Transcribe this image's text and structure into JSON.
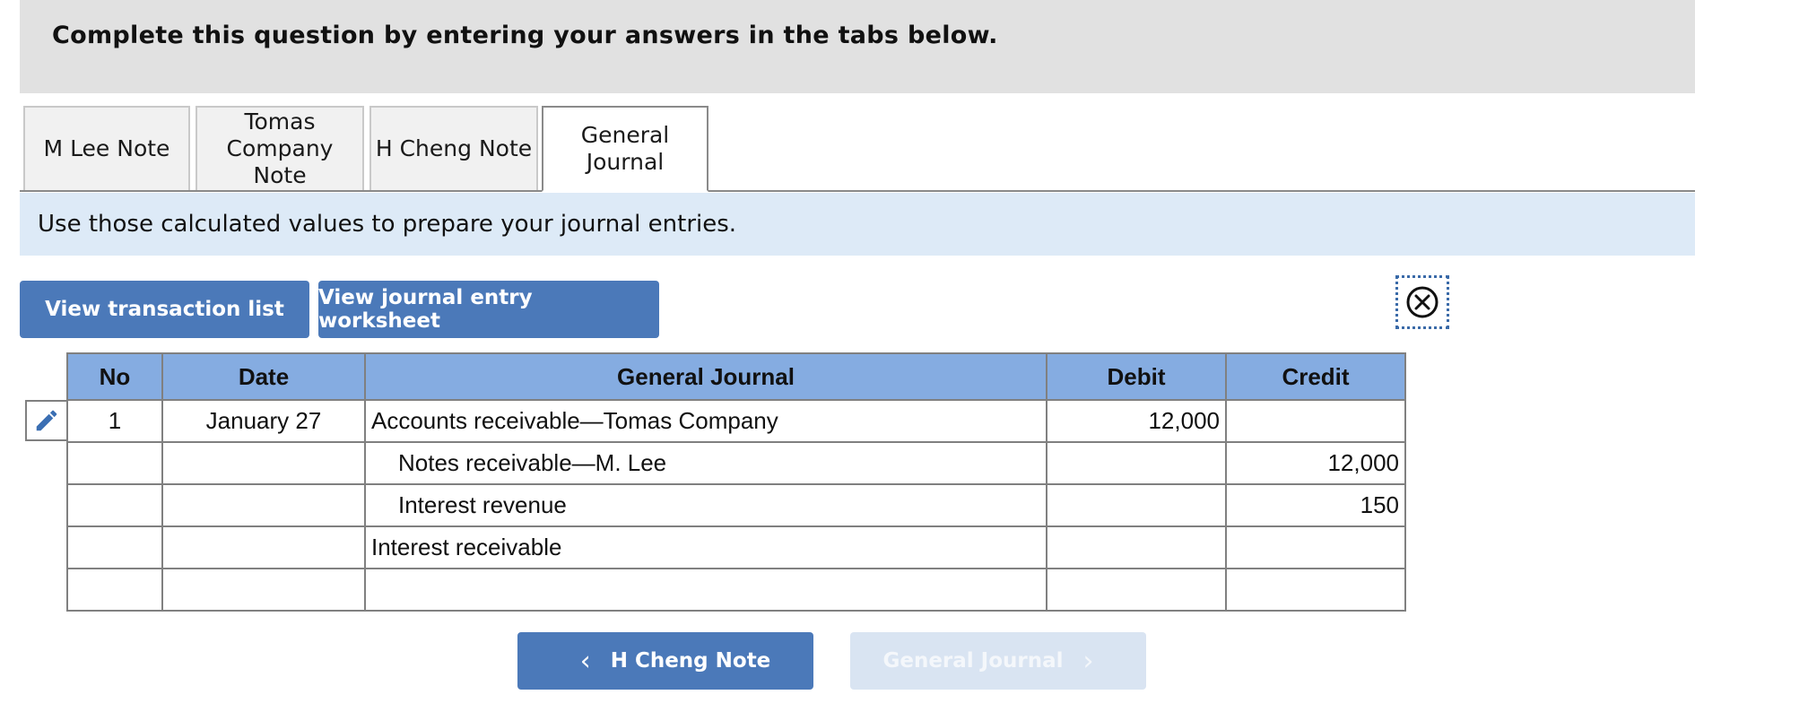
{
  "instructions": "Complete this question by entering your answers in the tabs below.",
  "tabs": [
    {
      "label": "M Lee Note"
    },
    {
      "label": "Tomas\nCompany Note"
    },
    {
      "label": "H Cheng Note"
    },
    {
      "label": "General\nJournal",
      "active": true
    }
  ],
  "info_text": "Use those calculated values to prepare your journal entries.",
  "buttons": {
    "view_transaction_list": "View transaction list",
    "view_journal_worksheet": "View journal entry worksheet"
  },
  "table": {
    "headers": {
      "no": "No",
      "date": "Date",
      "journal": "General Journal",
      "debit": "Debit",
      "credit": "Credit"
    },
    "rows": [
      {
        "no": "1",
        "date": "January 27",
        "account": "Accounts receivable—Tomas Company",
        "debit": "12,000",
        "credit": ""
      },
      {
        "no": "",
        "date": "",
        "account": "Notes receivable—M. Lee",
        "debit": "",
        "credit": "12,000"
      },
      {
        "no": "",
        "date": "",
        "account": "Interest revenue",
        "debit": "",
        "credit": "150"
      },
      {
        "no": "",
        "date": "",
        "account": "Interest receivable",
        "debit": "",
        "credit": ""
      },
      {
        "no": "",
        "date": "",
        "account": "",
        "debit": "",
        "credit": ""
      }
    ]
  },
  "nav": {
    "prev_label": "H Cheng Note",
    "next_label": "General Journal"
  },
  "colors": {
    "header_band": "#e1e1e1",
    "info_band": "#ddeaf7",
    "button_blue": "#4b79b9",
    "table_header": "#85ace1",
    "disabled_button": "#d9e4f2"
  },
  "icons": {
    "close": "circle-x-icon",
    "edit": "pencil-icon",
    "prev": "chevron-left-icon",
    "next": "chevron-right-icon"
  }
}
